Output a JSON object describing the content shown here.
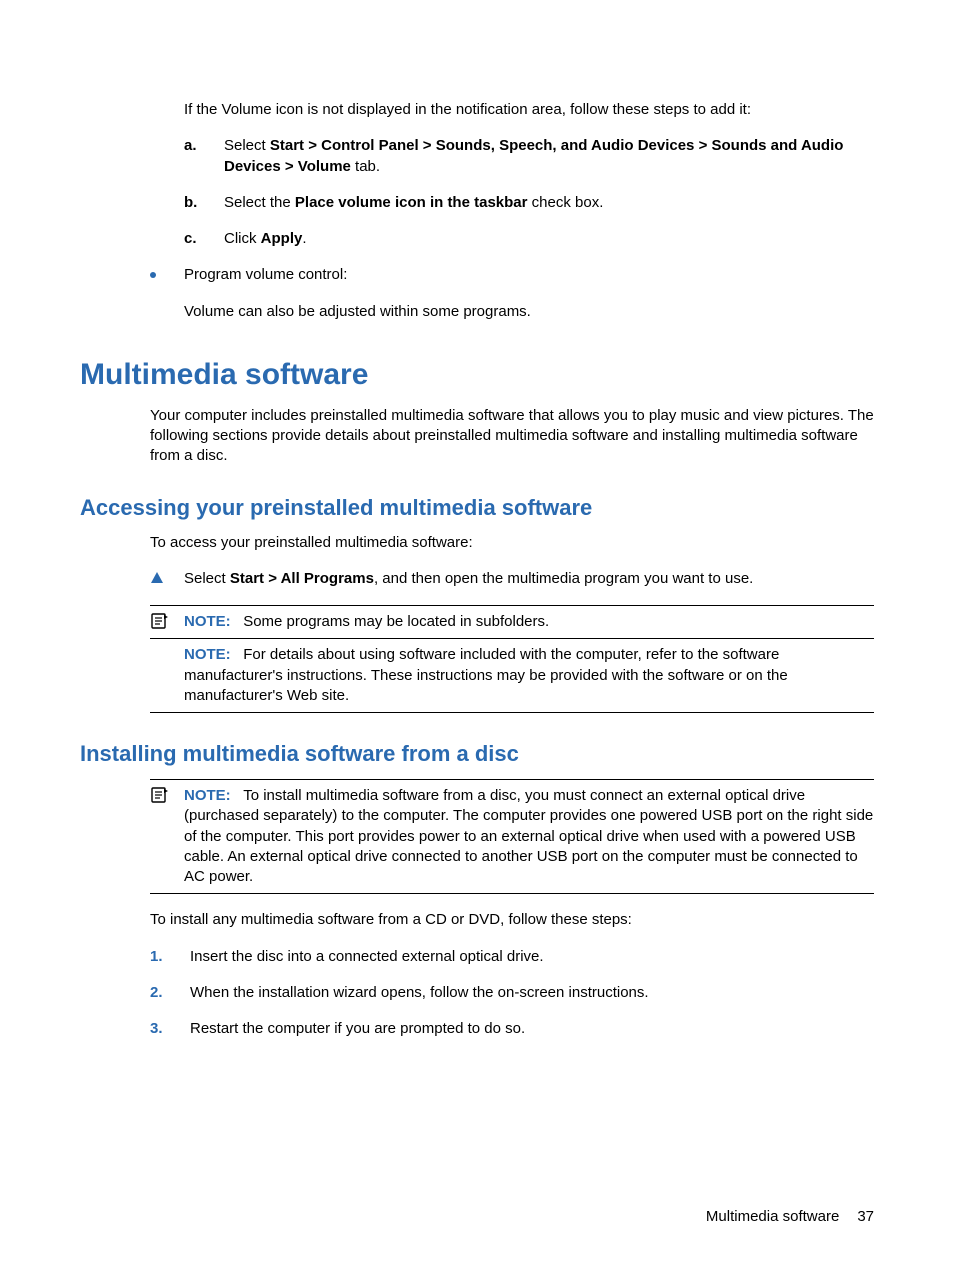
{
  "intro_line": "If the Volume icon is not displayed in the notification area, follow these steps to add it:",
  "step_a_marker": "a.",
  "step_a_prefix": "Select ",
  "step_a_bold1": "Start > Control Panel > Sounds, Speech, and Audio Devices > Sounds and Audio Devices > Volume",
  "step_a_suffix": " tab.",
  "step_b_marker": "b.",
  "step_b_prefix": "Select the ",
  "step_b_bold1": "Place volume icon in the taskbar",
  "step_b_suffix": " check box.",
  "step_c_marker": "c.",
  "step_c_prefix": "Click ",
  "step_c_bold1": "Apply",
  "step_c_suffix": ".",
  "bullet_program_volume": "Program volume control:",
  "bullet_program_volume_body": "Volume can also be adjusted within some programs.",
  "h1": "Multimedia software",
  "h1_para": "Your computer includes preinstalled multimedia software that allows you to play music and view pictures. The following sections provide details about preinstalled multimedia software and installing multimedia software from a disc.",
  "h2a": "Accessing your preinstalled multimedia software",
  "h2a_intro": "To access your preinstalled multimedia software:",
  "h2a_step_prefix": "Select ",
  "h2a_step_bold": "Start > All Programs",
  "h2a_step_suffix": ", and then open the multimedia program you want to use.",
  "note_label": "NOTE:",
  "h2a_note1_text": "Some programs may be located in subfolders.",
  "h2a_note2_text": "For details about using software included with the computer, refer to the software manufacturer's instructions. These instructions may be provided with the software or on the manufacturer's Web site.",
  "h2b": "Installing multimedia software from a disc",
  "h2b_note_text": "To install multimedia software from a disc, you must connect an external optical drive (purchased separately) to the computer. The computer provides one powered USB port on the right side of the computer. This port provides power to an external optical drive when used with a powered USB cable. An external optical drive connected to another USB port on the computer must be connected to AC power.",
  "h2b_intro": "To install any multimedia software from a CD or DVD, follow these steps:",
  "ol1_marker": "1.",
  "ol1_text": "Insert the disc into a connected external optical drive.",
  "ol2_marker": "2.",
  "ol2_text": "When the installation wizard opens, follow the on-screen instructions.",
  "ol3_marker": "3.",
  "ol3_text": "Restart the computer if you are prompted to do so.",
  "footer_label": "Multimedia software",
  "footer_page": "37"
}
